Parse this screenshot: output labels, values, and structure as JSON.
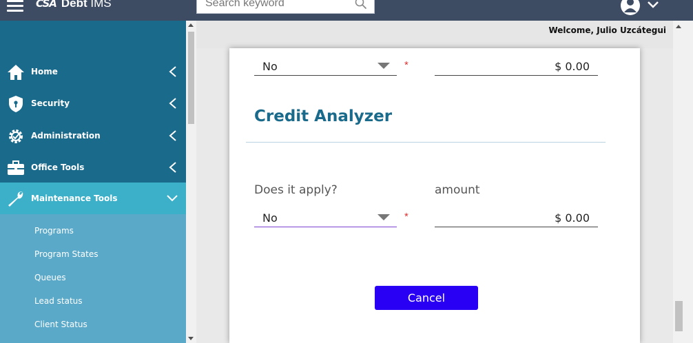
{
  "app": {
    "logo_mark": "CSA",
    "name_bold": "Debt",
    "name_rest": " IMS"
  },
  "search": {
    "placeholder": "Search keyword"
  },
  "sidebar": {
    "items": [
      {
        "label": "Home",
        "icon": "home-icon"
      },
      {
        "label": "Security",
        "icon": "shield-icon"
      },
      {
        "label": "Administration",
        "icon": "gear-icon"
      },
      {
        "label": "Office Tools",
        "icon": "briefcase-icon"
      },
      {
        "label": "Maintenance Tools",
        "icon": "wrench-icon"
      }
    ],
    "subitems": [
      {
        "label": "Programs"
      },
      {
        "label": "Program States"
      },
      {
        "label": "Queues"
      },
      {
        "label": "Lead status"
      },
      {
        "label": "Client Status"
      }
    ]
  },
  "header": {
    "welcome": "Welcome, Julio Uzcátegui"
  },
  "form": {
    "top_select_value": "No",
    "top_amount_value": "$ 0.00",
    "section_title": "Credit Analyzer",
    "applies_label": "Does it apply?",
    "amount_label": "amount",
    "applies_value": "No",
    "amount_value": "$ 0.00",
    "required_mark": "*",
    "cancel_label": "Cancel"
  },
  "colors": {
    "topbar": "#3d4b63",
    "sidebar": "#1a6a8b",
    "sidebar_active": "#3cb0c9",
    "submenu": "#5aa9c9",
    "accent_title": "#1a6a8b",
    "cancel_button": "#2a00f5"
  }
}
